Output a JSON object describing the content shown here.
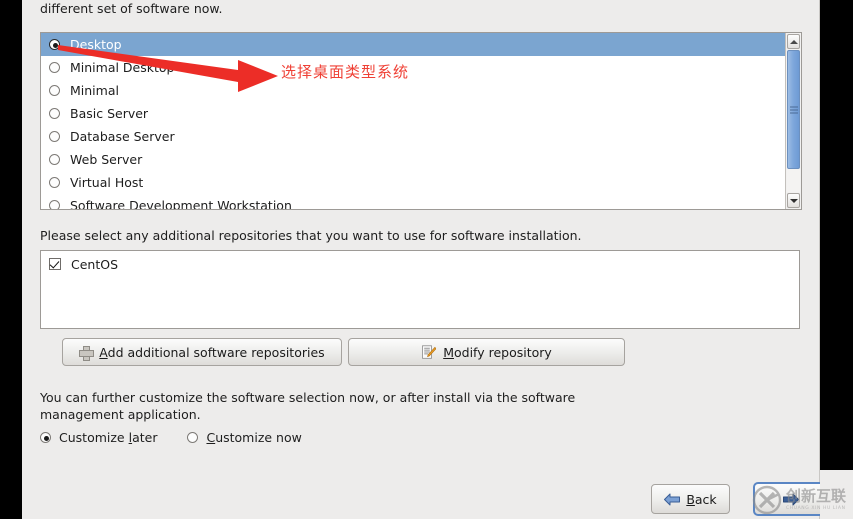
{
  "dialog": {
    "intro_text": "different set of software now.",
    "repo_prompt": "Please select any additional repositories that you want to use for software installation.",
    "customize_text": "You can further customize the software selection now, or after install via the software management application."
  },
  "software_groups": {
    "items": [
      {
        "label": "Desktop",
        "selected": true
      },
      {
        "label": "Minimal Desktop",
        "selected": false
      },
      {
        "label": "Minimal",
        "selected": false
      },
      {
        "label": "Basic Server",
        "selected": false
      },
      {
        "label": "Database Server",
        "selected": false
      },
      {
        "label": "Web Server",
        "selected": false
      },
      {
        "label": "Virtual Host",
        "selected": false
      },
      {
        "label": "Software Development Workstation",
        "selected": false
      }
    ],
    "selected_value": "Desktop",
    "selected_bg": "#7ba5d0",
    "scrollbar": {
      "up_icon": "chevron-up-icon",
      "down_icon": "chevron-down-icon",
      "thumb_color": "#7fa8dc"
    }
  },
  "repositories": {
    "items": [
      {
        "label": "CentOS",
        "checked": true
      }
    ]
  },
  "buttons": {
    "add_repo": {
      "label_mnemonic": "A",
      "label_rest": "dd additional software repositories",
      "icon": "plus-icon"
    },
    "modify_repo": {
      "label_mnemonic": "M",
      "label_rest": "odify repository",
      "icon": "edit-document-icon"
    },
    "back": {
      "label_mnemonic": "B",
      "label_rest": "ack",
      "icon": "arrow-left-icon"
    },
    "next": {
      "label": "",
      "icon": "arrow-right-icon",
      "focus_border": "#5a86c4"
    }
  },
  "customize": {
    "options": [
      {
        "mnemonic_pre": "Customize ",
        "mnemonic": "l",
        "rest": "ater",
        "selected": true
      },
      {
        "mnemonic_pre": "",
        "mnemonic": "C",
        "rest": "ustomize now",
        "selected": false
      }
    ]
  },
  "annotation": {
    "text": "选择桌面类型系统",
    "color": "#ef4136",
    "arrow": "red-arrow-right"
  },
  "watermark": {
    "cn": "创新互联",
    "en": "CHUANG XIN HU LIAN",
    "logo": "circle-x-logo"
  }
}
